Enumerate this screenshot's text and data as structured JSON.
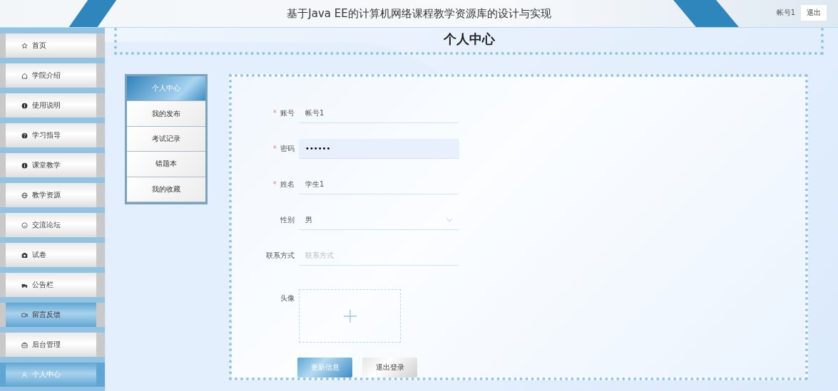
{
  "header": {
    "title": "基于Java EE的计算机网络课程教学资源库的设计与实现",
    "username": "帐号1",
    "logout": "退出"
  },
  "sidebar": {
    "items": [
      {
        "label": "首页",
        "selected": false,
        "hovered": false
      },
      {
        "label": "学院介绍",
        "selected": false,
        "hovered": false
      },
      {
        "label": "使用说明",
        "selected": false,
        "hovered": false
      },
      {
        "label": "学习指导",
        "selected": false,
        "hovered": false
      },
      {
        "label": "课堂教学",
        "selected": false,
        "hovered": false
      },
      {
        "label": "教学资源",
        "selected": false,
        "hovered": false
      },
      {
        "label": "交流论坛",
        "selected": false,
        "hovered": false
      },
      {
        "label": "试卷",
        "selected": false,
        "hovered": false
      },
      {
        "label": "公告栏",
        "selected": false,
        "hovered": false
      },
      {
        "label": "留言反馈",
        "selected": false,
        "hovered": true
      },
      {
        "label": "后台管理",
        "selected": false,
        "hovered": false
      },
      {
        "label": "个人中心",
        "selected": true,
        "hovered": false
      }
    ]
  },
  "page_heading": "个人中心",
  "submenu": {
    "items": [
      {
        "label": "个人中心",
        "selected": true
      },
      {
        "label": "我的发布",
        "selected": false
      },
      {
        "label": "考试记录",
        "selected": false
      },
      {
        "label": "错题本",
        "selected": false
      },
      {
        "label": "我的收藏",
        "selected": false
      }
    ]
  },
  "form": {
    "fields": [
      {
        "kind": "text",
        "label": "账号",
        "required_mark": "*",
        "value": "帐号1"
      },
      {
        "kind": "password",
        "label": "密码",
        "required_mark": "*",
        "value": "••••••"
      },
      {
        "kind": "text",
        "label": "姓名",
        "required_mark": "*",
        "value": "学生1"
      },
      {
        "kind": "select",
        "label": "性别",
        "value": "男"
      },
      {
        "kind": "text",
        "label": "联系方式",
        "placeholder": "联系方式"
      },
      {
        "kind": "upload",
        "label": "头像"
      }
    ],
    "buttons": [
      {
        "label": "更新信息",
        "kind": "primary"
      },
      {
        "label": "退出登录",
        "kind": "secondary"
      }
    ]
  }
}
